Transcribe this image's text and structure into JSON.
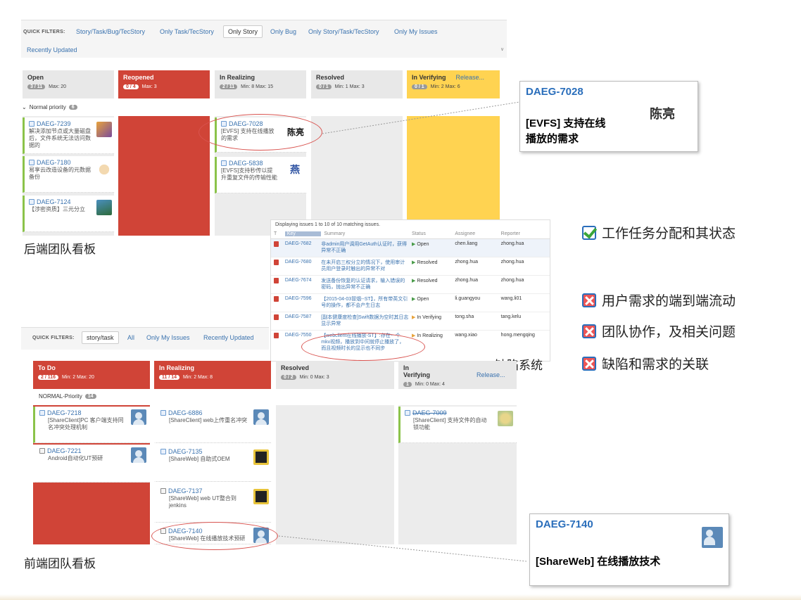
{
  "top_board": {
    "quick_filters_label": "QUICK FILTERS:",
    "quick_filters": [
      "Story/Task/Bug/TecStory",
      "Only Task/TecStory",
      "Only Story",
      "Only Bug",
      "Only Story/Task/TecStory",
      "Only My Issues"
    ],
    "quick_filters_row2": "Recently Updated",
    "active_filter": "Only Story",
    "columns": [
      {
        "title": "Open",
        "badge": "3 / 11",
        "meta": "Max: 20"
      },
      {
        "title": "Reopened",
        "badge": "0 / 4",
        "meta": "Max: 3"
      },
      {
        "title": "In Realizing",
        "badge": "2 / 11",
        "meta": "Min: 8   Max: 15"
      },
      {
        "title": "Resolved",
        "badge": "0 / 1",
        "meta": "Min: 1   Max: 3"
      },
      {
        "title": "In Verifying",
        "extra": "Release...",
        "badge": "0 / 1",
        "meta": "Min: 2   Max: 6"
      }
    ],
    "swimlane": "Normal priority",
    "swimlane_count": "6",
    "cards": [
      {
        "key": "DAEG-7239",
        "summary": "解决添加节点或大量磁盘后，文件系统无法访问数据的"
      },
      {
        "key": "DAEG-7180",
        "summary": "易享云改造设备的元数据备份"
      },
      {
        "key": "DAEG-7124",
        "summary": "【涉密资质】三元分立"
      },
      {
        "key": "DAEG-7028",
        "summary": "[EVFS] 支持在线播放的需求",
        "assignee_sig": "陈亮"
      },
      {
        "key": "DAEG-5838",
        "summary": "[EVFS]支持秒传以提升重复文件的传输性能",
        "assignee_sig": "燕"
      }
    ],
    "caption": "后端团队看板"
  },
  "issue_table": {
    "status_line": "Displaying issues 1 to 10 of 10 matching issues.",
    "headers": [
      "T",
      "Key",
      "Summary",
      "Status",
      "Assignee",
      "Reporter"
    ],
    "rows": [
      {
        "key": "DAEG-7682",
        "summary": "非admin用户调用GetAuth认证时，获得异常不正确",
        "status": "Open",
        "assignee": "chen.liang",
        "reporter": "zhong.hua"
      },
      {
        "key": "DAEG-7680",
        "summary": "在未开启三权分立的情况下，使用审计员用户登录时触出的异常不对",
        "status": "Resolved",
        "assignee": "zhong.hua",
        "reporter": "zhong.hua"
      },
      {
        "key": "DAEG-7674",
        "summary": "发送备份恢复的认证请求，输入错误的密码，抛出异常不正确",
        "status": "Resolved",
        "assignee": "zhong.hua",
        "reporter": "zhong.hua"
      },
      {
        "key": "DAEG-7596",
        "summary": "【2015-04-03冒烟--ST】，所有带英文引号的操作，都不会产生日志",
        "status": "Open",
        "assignee": "li.guangyou",
        "reporter": "wang.li01"
      },
      {
        "key": "DAEG-7587",
        "summary": "[副本健康度检查]Swift数据为空时其日志显示异常",
        "status": "In Verifying",
        "assignee": "tong.sha",
        "reporter": "tang.kelu"
      },
      {
        "key": "DAEG-7550",
        "summary": "【webclient在线播放-ST】:存在一个mkv视频，播放到中间就停止播放了，而且视频时长的显示也不同步",
        "status": "In Realizing",
        "assignee": "wang.xiao",
        "reporter": "hong.mengqing"
      }
    ],
    "caption": "缺陷系统"
  },
  "bottom_board": {
    "quick_filters_label": "QUICK FILTERS:",
    "quick_filters": [
      "story/task",
      "All",
      "Only My Issues",
      "Recently Updated"
    ],
    "columns": [
      {
        "title": "To Do",
        "badge": "2 / 116",
        "meta": "Min: 2   Max: 20"
      },
      {
        "title": "In Realizing",
        "badge": "11 / 14",
        "meta": "Min: 2   Max: 8"
      },
      {
        "title": "Resolved",
        "badge": "0 / 2",
        "meta": "Min: 0   Max: 3"
      },
      {
        "title": "In Verifying",
        "extra": "Release...",
        "badge": "1",
        "meta": "Min: 0   Max: 4"
      }
    ],
    "swimlane": "NORMAL-Priority",
    "swimlane_count": "14",
    "cards": [
      {
        "key": "DAEG-7218",
        "summary": "[ShareClient]PC 客户端支持同名冲突处理机制"
      },
      {
        "key": "DAEG-7221",
        "summary": "Android自动化UT预研"
      },
      {
        "key": "DAEG-6886",
        "summary": "[ShareClient] web上传重名冲突"
      },
      {
        "key": "DAEG-7135",
        "summary": "[ShareWeb] 自助式OEM"
      },
      {
        "key": "DAEG-7137",
        "summary": "[ShareWeb] web UT整合到jenkins"
      },
      {
        "key": "DAEG-7140",
        "summary": "[ShareWeb] 在线播放技术预研"
      },
      {
        "key": "DAEG-7009",
        "summary": "[ShareClient] 支持文件的自动锁功能"
      }
    ],
    "caption": "前端团队看板"
  },
  "callouts": [
    {
      "key": "DAEG-7028",
      "summary_line1": "[EVFS] 支持在线",
      "summary_line2": "播放的需求",
      "sig": "陈亮"
    },
    {
      "key": "DAEG-7140",
      "summary": "[ShareWeb] 在线播放技术"
    }
  ],
  "legend": [
    {
      "text": "工作任务分配和其状态",
      "state": "checked"
    },
    {
      "text": "用户需求的端到端流动",
      "state": "crossed"
    },
    {
      "text": "团队协作，及相关问题",
      "state": "crossed"
    },
    {
      "text": "缺陷和需求的关联",
      "state": "crossed"
    }
  ],
  "colors": {
    "accent": "#3b73af",
    "reopened": "#d04437",
    "verifying": "#ffd351",
    "ellipse": "#d9534f",
    "lane_bar": "#8bc34a"
  }
}
